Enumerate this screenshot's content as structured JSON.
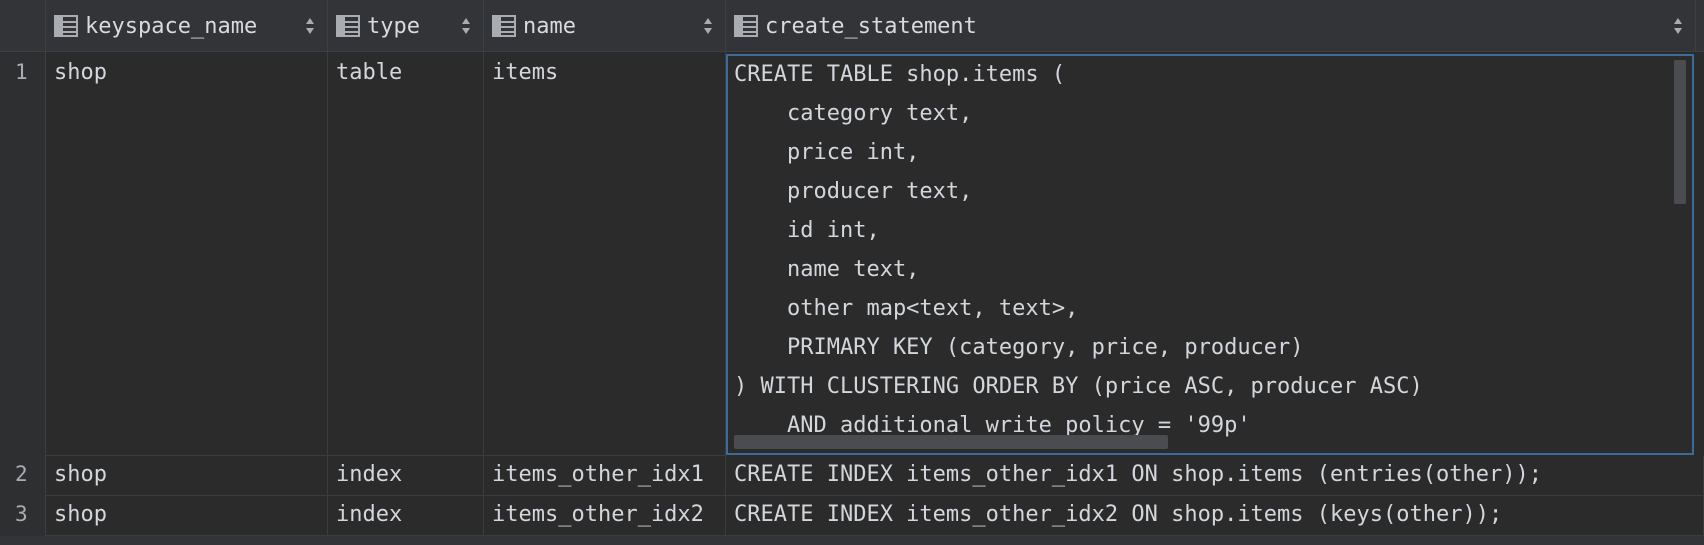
{
  "columns": [
    {
      "label": "keyspace_name"
    },
    {
      "label": "type"
    },
    {
      "label": "name"
    },
    {
      "label": "create_statement"
    }
  ],
  "rows": [
    {
      "num": "1",
      "keyspace_name": "shop",
      "type": "table",
      "name": "items"
    },
    {
      "num": "2",
      "keyspace_name": "shop",
      "type": "index",
      "name": "items_other_idx1",
      "create_statement": "CREATE INDEX items_other_idx1 ON shop.items (entries(other));"
    },
    {
      "num": "3",
      "keyspace_name": "shop",
      "type": "index",
      "name": "items_other_idx2",
      "create_statement": "CREATE INDEX items_other_idx2 ON shop.items (keys(other));"
    }
  ],
  "editor": {
    "lines": [
      "CREATE TABLE shop.items (",
      "    category text,",
      "    price int,",
      "    producer text,",
      "    id int,",
      "    name text,",
      "    other map<text, text>,",
      "    PRIMARY KEY (category, price, producer)",
      ") WITH CLUSTERING ORDER BY (price ASC, producer ASC)",
      "    AND additional_write_policy = '99p'"
    ]
  },
  "colors": {
    "background": "#2b2b2b",
    "header": "#323437",
    "selection_border": "#3d6b99",
    "text": "#d3d6db"
  },
  "icons": {
    "column_header": "table-column-icon",
    "sort": "sort-arrows-icon"
  }
}
